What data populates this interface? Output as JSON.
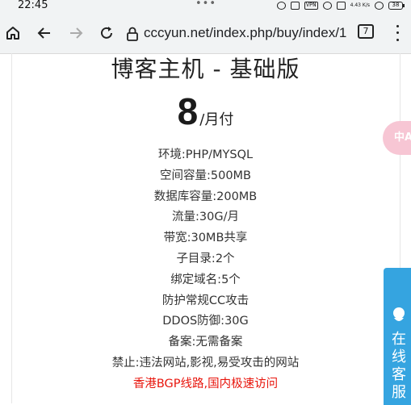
{
  "status_bar": {
    "time": "22:45",
    "dots": "•••",
    "vpn_label": "VPN",
    "speed": "4.43 K/s",
    "battery": "38"
  },
  "browser": {
    "url": "cccyun.net/index.php/buy/index/1",
    "tab_count": "7"
  },
  "plan": {
    "title": "博客主机 - 基础版",
    "price": "8",
    "price_unit": "/月付",
    "features": [
      "环境:PHP/MYSQL",
      "空间容量:500MB",
      "数据库容量:200MB",
      "流量:30G/月",
      "带宽:30MB共享",
      "子目录:2个",
      "绑定域名:5个",
      "防护常规CC攻击",
      "DDOS防御:30G",
      "备案:无需备案",
      "禁止:违法网站,影视,易受攻击的网站"
    ],
    "highlight": "香港BGP线路,国内极速访问"
  },
  "floating": {
    "translate_label": "中A",
    "service_label": "在线客服"
  },
  "colors": {
    "highlight": "#e8150c",
    "service_bg": "#35a4e0",
    "translate_bg": "#f7c6d4"
  }
}
